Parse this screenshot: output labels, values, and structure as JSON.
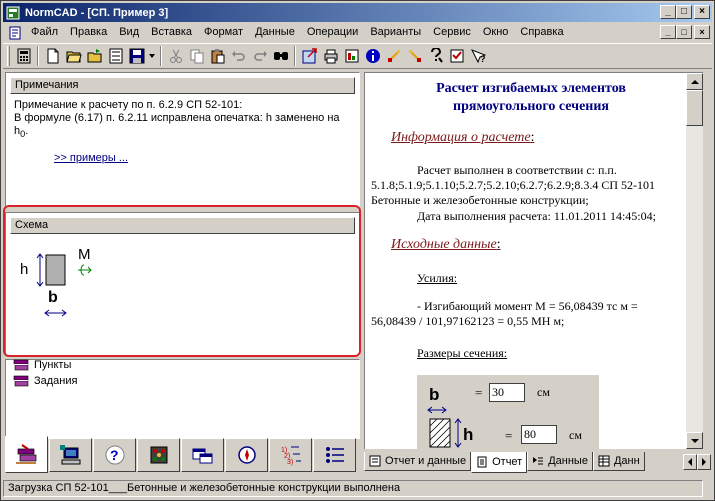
{
  "window": {
    "title": "NormCAD - [СП. Пример 3]",
    "buttons": {
      "minimize": "_",
      "maximize": "□",
      "close": "×"
    }
  },
  "menu": {
    "items": [
      "Файл",
      "Правка",
      "Вид",
      "Вставка",
      "Формат",
      "Данные",
      "Операции",
      "Варианты",
      "Сервис",
      "Окно",
      "Справка"
    ]
  },
  "toolbar": {
    "buttons": [
      "calculator-icon",
      "new-document-icon",
      "open-folder-icon",
      "open-recent-icon",
      "preview-icon",
      "save-icon",
      "dropdown-arrow-icon",
      "cut-icon",
      "copy-icon",
      "paste-icon",
      "undo-icon",
      "redo-icon",
      "find-icon",
      "export-icon",
      "print-setup-icon",
      "report-icon",
      "info-icon",
      "prev-step-icon",
      "next-step-icon",
      "help-icon",
      "settings-icon",
      "context-help-icon"
    ]
  },
  "notes": {
    "header": "Примечания",
    "line1": "Примечание к расчету по п. 6.2.9 СП 52-101:",
    "line2": "В формуле (6.17) п. 6.2.11 исправлена опечатка: h заменено на h",
    "line2_sub": "0",
    "line2_end": ".",
    "link": ">> примеры ..."
  },
  "scheme": {
    "header": "Схема",
    "h_label": "h",
    "b_label": "b",
    "m_label": "M"
  },
  "tree": {
    "items": [
      "Пункты",
      "Задания"
    ]
  },
  "left_tabs": [
    "book-icon",
    "computer-icon",
    "help-icon",
    "traffic-light-icon",
    "windows-icon",
    "compass-icon",
    "numbered-list-icon",
    "bullet-list-icon"
  ],
  "document": {
    "title": "Расчет изгибаемых элементов прямоугольного сечения",
    "info_heading": "Информация о расчете",
    "info_p1": "Расчет выполнен в соответствии с: п.п. 5.1.8;5.1.9;5.1.10;5.2.7;5.2.10;6.2.7;6.2.9;8.3.4 СП 52-101 Бетонные и железобетонные конструкции;",
    "info_p2": "Дата выполнения расчета: 11.01.2011 14:45:04;",
    "input_heading": "Исходные данные",
    "forces_heading": "Усилия:",
    "forces_text": "- Изгибающий момент M = 56,08439 тс м = 56,08439 / 101,97162123 = 0,55 МН м;",
    "sizes_heading": "Размеры сечения:",
    "size_b_label": "b",
    "size_b_value": "30",
    "size_h_label": "h",
    "size_h_value": "80",
    "unit": "см",
    "eq": "="
  },
  "right_tabs": [
    {
      "label": "Отчет и данные",
      "active": false
    },
    {
      "label": "Отчет",
      "active": true
    },
    {
      "label": "Данные",
      "active": false
    },
    {
      "label": "Данн",
      "active": false
    }
  ],
  "status": {
    "text": "Загрузка  СП 52-101___Бетонные и железобетонные конструкции выполнена"
  },
  "colors": {
    "title_gradient_start": "#0a246a",
    "title_gradient_end": "#a6caf0",
    "doc_title": "#000080",
    "doc_heading": "#7b1a1a",
    "highlight_outline": "#d8232a"
  }
}
